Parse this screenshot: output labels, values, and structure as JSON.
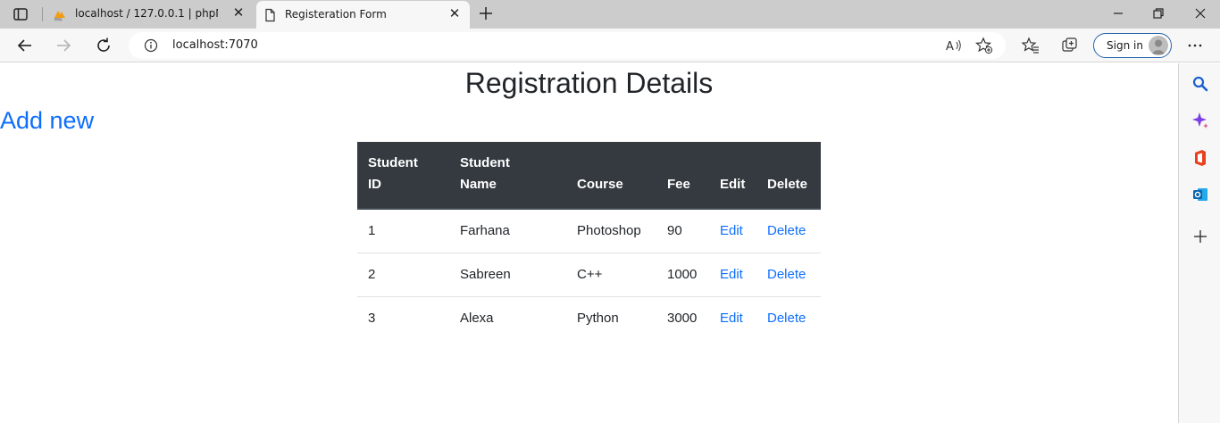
{
  "browser": {
    "tabs": [
      {
        "title": "localhost / 127.0.0.1 | phpMyAdmin",
        "favicon": "phpmyadmin-icon",
        "active": false
      },
      {
        "title": "Registeration Form",
        "favicon": "page-icon",
        "active": true
      }
    ],
    "address": {
      "url": "localhost:7070"
    },
    "signin_label": "Sign in",
    "accent": "#2563a8"
  },
  "page": {
    "heading": "Registration Details",
    "add_new_label": "Add new",
    "link_color": "#0d6efd",
    "header_bg": "#343a40"
  },
  "table": {
    "headers": {
      "id": [
        "Student",
        "ID"
      ],
      "name": [
        "Student",
        "Name"
      ],
      "course": "Course",
      "fee": "Fee",
      "edit": "Edit",
      "delete": "Delete"
    },
    "rows": [
      {
        "id": "1",
        "name": "Farhana",
        "course": "Photoshop",
        "fee": "90",
        "edit": "Edit",
        "delete": "Delete"
      },
      {
        "id": "2",
        "name": "Sabreen",
        "course": "C++",
        "fee": "1000",
        "edit": "Edit",
        "delete": "Delete"
      },
      {
        "id": "3",
        "name": "Alexa",
        "course": "Python",
        "fee": "3000",
        "edit": "Edit",
        "delete": "Delete"
      }
    ]
  }
}
